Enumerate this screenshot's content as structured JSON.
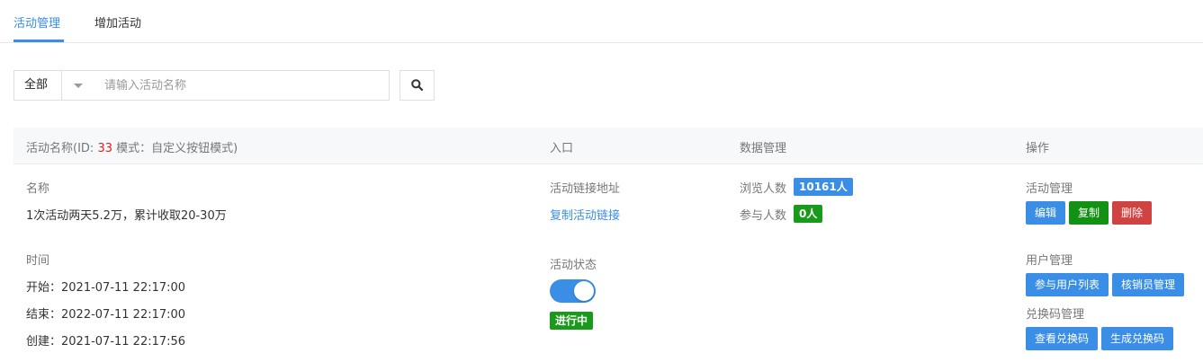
{
  "tabs": [
    {
      "label": "活动管理",
      "active": true
    },
    {
      "label": "增加活动",
      "active": false
    }
  ],
  "filter": {
    "select_value": "全部",
    "search_placeholder": "请输入活动名称"
  },
  "table": {
    "headers": {
      "name_prefix": "活动名称(ID: ",
      "id": "33",
      "name_suffix": " 模式：自定义按钮模式)",
      "entry": "入口",
      "data": "数据管理",
      "actions": "操作"
    }
  },
  "row": {
    "name_label": "名称",
    "name": "1次活动两天5.2万，累计收取20-30万",
    "time_label": "时间",
    "start": "开始：2021-07-11 22:17:00",
    "end": "结束：2022-07-11 22:17:00",
    "created": "创建：2021-07-11 22:17:56",
    "link_label": "活动链接地址",
    "copy_link": "复制活动链接",
    "status_label": "活动状态",
    "status_on": true,
    "status_badge": "进行中",
    "views_label": "浏览人数",
    "views_value": "10161人",
    "participants_label": "参与人数",
    "participants_value": "0人",
    "activity_mgmt_label": "活动管理",
    "edit_btn": "编辑",
    "copy_btn": "复制",
    "delete_btn": "删除",
    "user_mgmt_label": "用户管理",
    "participants_list_btn": "参与用户列表",
    "verifier_btn": "核销员管理",
    "code_mgmt_label": "兑换码管理",
    "view_codes_btn": "查看兑换码",
    "gen_codes_btn": "生成兑换码"
  },
  "colors": {
    "accent": "#3a8ee6",
    "success": "#139113",
    "danger": "#cf4343",
    "id_red": "#e02020"
  }
}
